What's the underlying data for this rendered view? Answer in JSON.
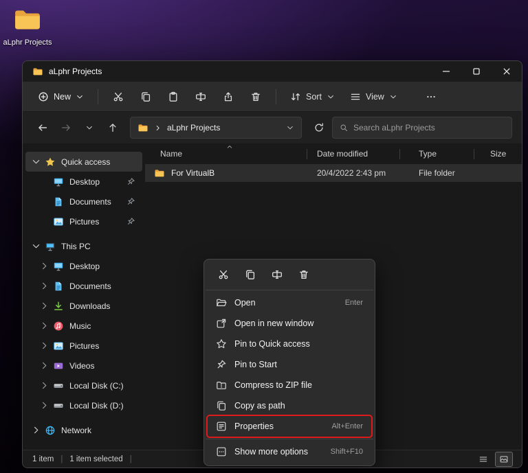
{
  "desktop": {
    "shortcut_label": "aLphr Projects"
  },
  "window": {
    "title": "aLphr Projects",
    "commandbar": {
      "new_label": "New",
      "sort_label": "Sort",
      "view_label": "View"
    },
    "addressbar": {
      "location": "aLphr Projects",
      "search_placeholder": "Search aLphr Projects"
    },
    "sidebar": {
      "items": [
        {
          "label": "Quick access",
          "icon": "star-fill"
        },
        {
          "label": "Desktop",
          "icon": "monitor"
        },
        {
          "label": "Documents",
          "icon": "doc"
        },
        {
          "label": "Pictures",
          "icon": "pic"
        },
        {
          "label": "This PC",
          "icon": "pc"
        },
        {
          "label": "Desktop",
          "icon": "monitor"
        },
        {
          "label": "Documents",
          "icon": "doc"
        },
        {
          "label": "Downloads",
          "icon": "download"
        },
        {
          "label": "Music",
          "icon": "music"
        },
        {
          "label": "Pictures",
          "icon": "pic"
        },
        {
          "label": "Videos",
          "icon": "video"
        },
        {
          "label": "Local Disk (C:)",
          "icon": "disk"
        },
        {
          "label": "Local Disk (D:)",
          "icon": "disk"
        },
        {
          "label": "Network",
          "icon": "network"
        }
      ]
    },
    "columns": [
      "Name",
      "Date modified",
      "Type",
      "Size"
    ],
    "files": [
      {
        "name": "For VirtualB",
        "date_modified": "20/4/2022 2:43 pm",
        "type": "File folder",
        "size": ""
      }
    ],
    "statusbar": {
      "items_count": "1 item",
      "selected_count": "1 item selected",
      "divider": "|"
    }
  },
  "context_menu": {
    "quick_actions": [
      "cut",
      "copy",
      "rename",
      "trash"
    ],
    "items": [
      {
        "label": "Open",
        "shortcut": "Enter",
        "icon": "open-folder"
      },
      {
        "label": "Open in new window",
        "shortcut": "",
        "icon": "new-window"
      },
      {
        "label": "Pin to Quick access",
        "shortcut": "",
        "icon": "star-line"
      },
      {
        "label": "Pin to Start",
        "shortcut": "",
        "icon": "pin-line"
      },
      {
        "label": "Compress to ZIP file",
        "shortcut": "",
        "icon": "zip"
      },
      {
        "label": "Copy as path",
        "shortcut": "",
        "icon": "copy-path"
      },
      {
        "label": "Properties",
        "shortcut": "Alt+Enter",
        "icon": "props"
      },
      {
        "label": "Show more options",
        "shortcut": "Shift+F10",
        "icon": "show-more"
      }
    ]
  }
}
